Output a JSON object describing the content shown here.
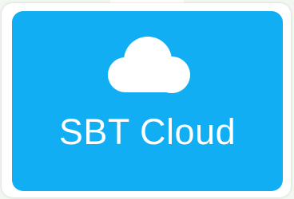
{
  "tile": {
    "label": "SBT Cloud",
    "icon": "cloud-icon",
    "background_color": "#12aef4",
    "icon_color": "#ffffff"
  }
}
